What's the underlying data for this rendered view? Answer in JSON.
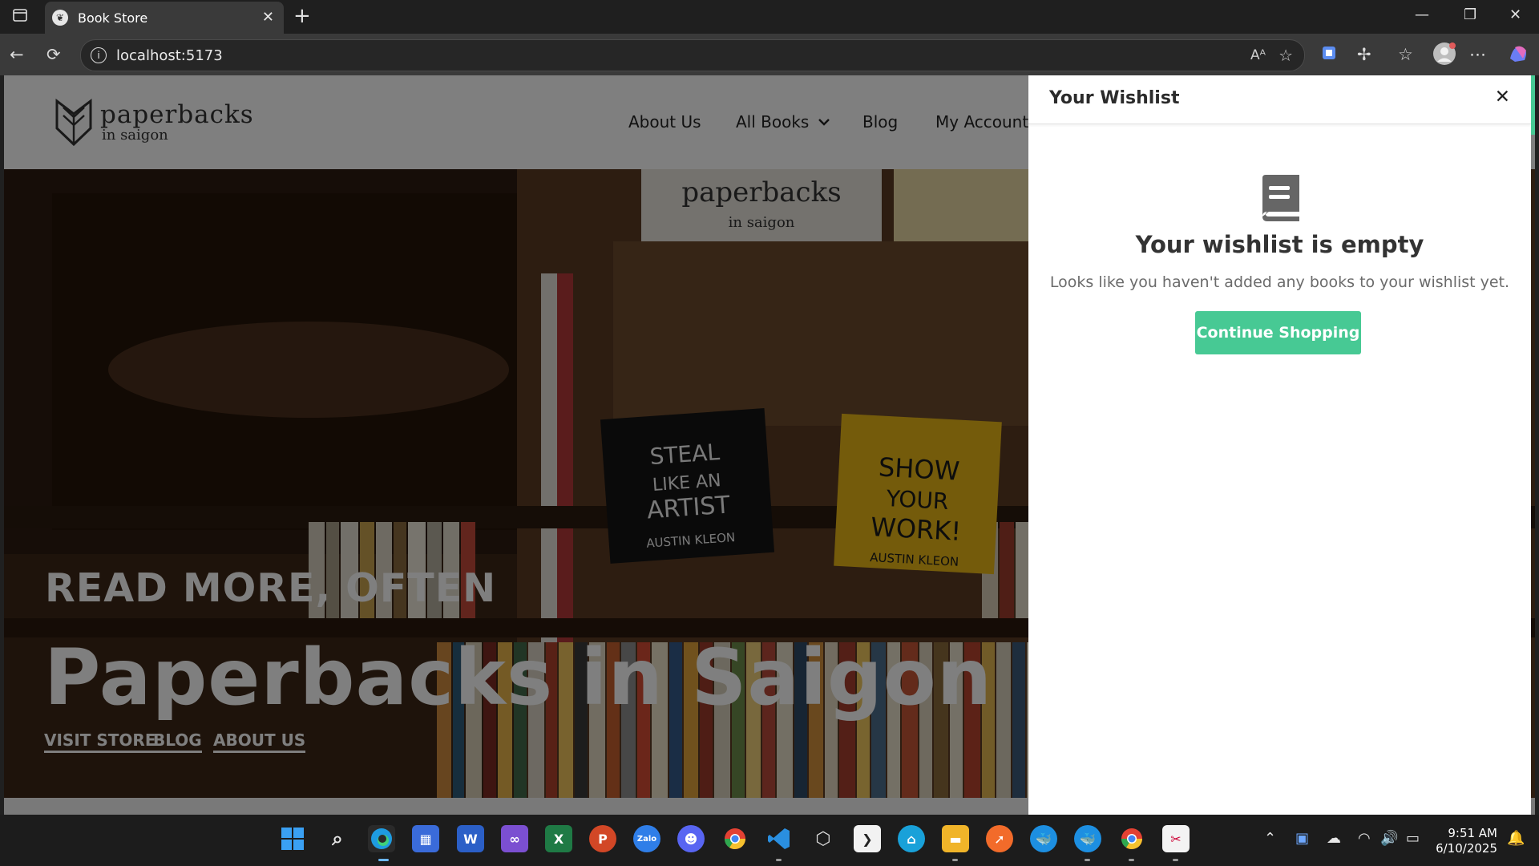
{
  "browser": {
    "tab_title": "Book Store",
    "url": "localhost:5173"
  },
  "site": {
    "logo_main": "paperbacks",
    "logo_sub": "in saigon",
    "nav": [
      "About Us",
      "All Books",
      "Blog",
      "My Account"
    ]
  },
  "hero": {
    "eyebrow": "READ MORE, OFTEN",
    "title": "Paperbacks in Saigon",
    "links": [
      "VISIT STORE",
      "BLOG",
      "ABOUT US"
    ],
    "books": [
      {
        "title": "STEAL LIKE AN ARTIST",
        "author": "AUSTIN KLEON"
      },
      {
        "title": "SHOW YOUR WORK!",
        "author": "AUSTIN KLEON"
      }
    ],
    "store_sign": [
      "paperbacks",
      "in saigon"
    ]
  },
  "wishlist": {
    "title": "Your Wishlist",
    "close": "✕",
    "empty_title": "Your wishlist is empty",
    "empty_sub": "Looks like you haven't added any books to your wishlist yet.",
    "cta": "Continue Shopping",
    "accent_color": "#47c994"
  },
  "taskbar": {
    "time": "9:51 AM",
    "date": "6/10/2025"
  }
}
